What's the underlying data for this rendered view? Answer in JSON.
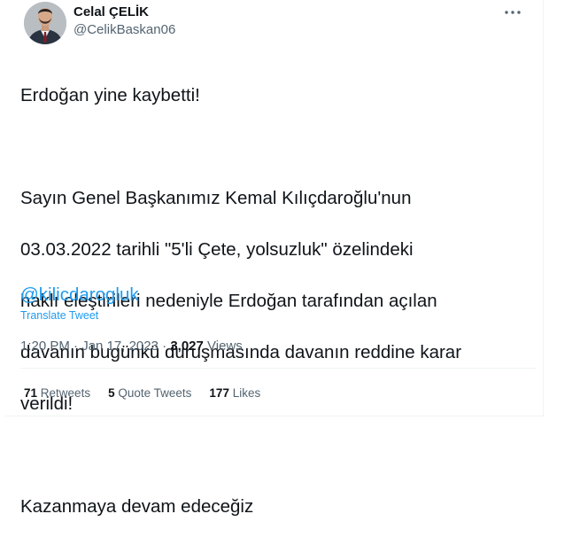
{
  "author": {
    "name": "Celal ÇELİK",
    "handle": "@CelikBaskan06"
  },
  "tweet": {
    "lines": [
      "Erdoğan yine kaybetti!",
      "",
      "Sayın Genel Başkanımız Kemal Kılıçdaroğlu'nun",
      "03.03.2022 tarihli \"5'li Çete, yolsuzluk\" özelindeki",
      "haklı eleştirileri nedeniyle Erdoğan tarafından açılan",
      "davanın bugünkü duruşmasında davanın reddine karar",
      "verildi!",
      "",
      "Kazanmaya devam edeceğiz"
    ],
    "mention": "@kilicdarogluk",
    "translate_label": "Translate Tweet"
  },
  "meta": {
    "time": "1:20 PM",
    "separator": " · ",
    "date": "Jan 17, 2023",
    "views_count": "3,027",
    "views_label": "Views"
  },
  "stats": {
    "retweets_count": "71",
    "retweets_label": "Retweets",
    "quotes_count": "5",
    "quotes_label": "Quote Tweets",
    "likes_count": "177",
    "likes_label": "Likes"
  },
  "icons": {
    "more": "more-horizontal-icon"
  },
  "colors": {
    "accent": "#1d9bf0",
    "text": "#0f1419",
    "secondary": "#536471",
    "border": "#eff3f4"
  }
}
